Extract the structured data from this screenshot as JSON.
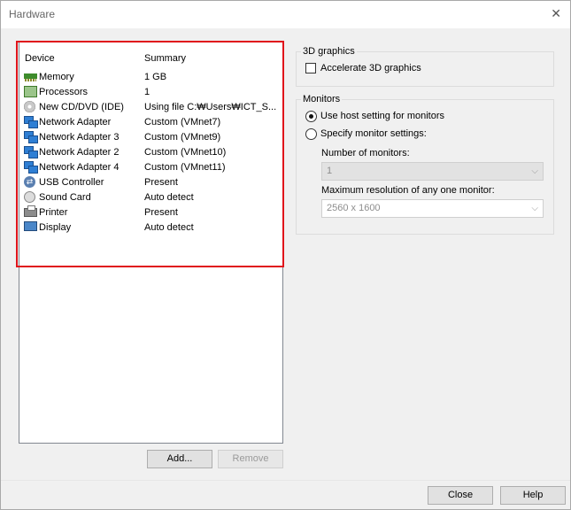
{
  "window": {
    "title": "Hardware",
    "close_glyph": "✕"
  },
  "device_list": {
    "headers": {
      "device": "Device",
      "summary": "Summary"
    },
    "rows": [
      {
        "icon": "memory-icon",
        "name": "Memory",
        "summary": "1 GB"
      },
      {
        "icon": "processor-icon",
        "name": "Processors",
        "summary": "1"
      },
      {
        "icon": "cd-dvd-icon",
        "name": "New CD/DVD (IDE)",
        "summary": "Using file C:₩Users₩ICT_S..."
      },
      {
        "icon": "network-adapter-icon",
        "name": "Network Adapter",
        "summary": "Custom (VMnet7)"
      },
      {
        "icon": "network-adapter-icon",
        "name": "Network Adapter 3",
        "summary": "Custom (VMnet9)"
      },
      {
        "icon": "network-adapter-icon",
        "name": "Network Adapter 2",
        "summary": "Custom (VMnet10)"
      },
      {
        "icon": "network-adapter-icon",
        "name": "Network Adapter 4",
        "summary": "Custom (VMnet11)"
      },
      {
        "icon": "usb-icon",
        "name": "USB Controller",
        "summary": "Present"
      },
      {
        "icon": "sound-card-icon",
        "name": "Sound Card",
        "summary": "Auto detect"
      },
      {
        "icon": "printer-icon",
        "name": "Printer",
        "summary": "Present"
      },
      {
        "icon": "display-icon",
        "name": "Display",
        "summary": "Auto detect"
      }
    ],
    "highlight_color": "#e0141b"
  },
  "buttons": {
    "add": "Add...",
    "remove": "Remove",
    "close": "Close",
    "help": "Help"
  },
  "graphics_3d": {
    "group_label": "3D graphics",
    "accelerate_label": "Accelerate 3D graphics",
    "accelerate_checked": false
  },
  "monitors": {
    "group_label": "Monitors",
    "use_host_label": "Use host setting for monitors",
    "specify_label": "Specify monitor settings:",
    "selected": "use_host",
    "number_label": "Number of monitors:",
    "number_value": "1",
    "max_res_label": "Maximum resolution of any one monitor:",
    "max_res_value": "2560 x 1600"
  }
}
